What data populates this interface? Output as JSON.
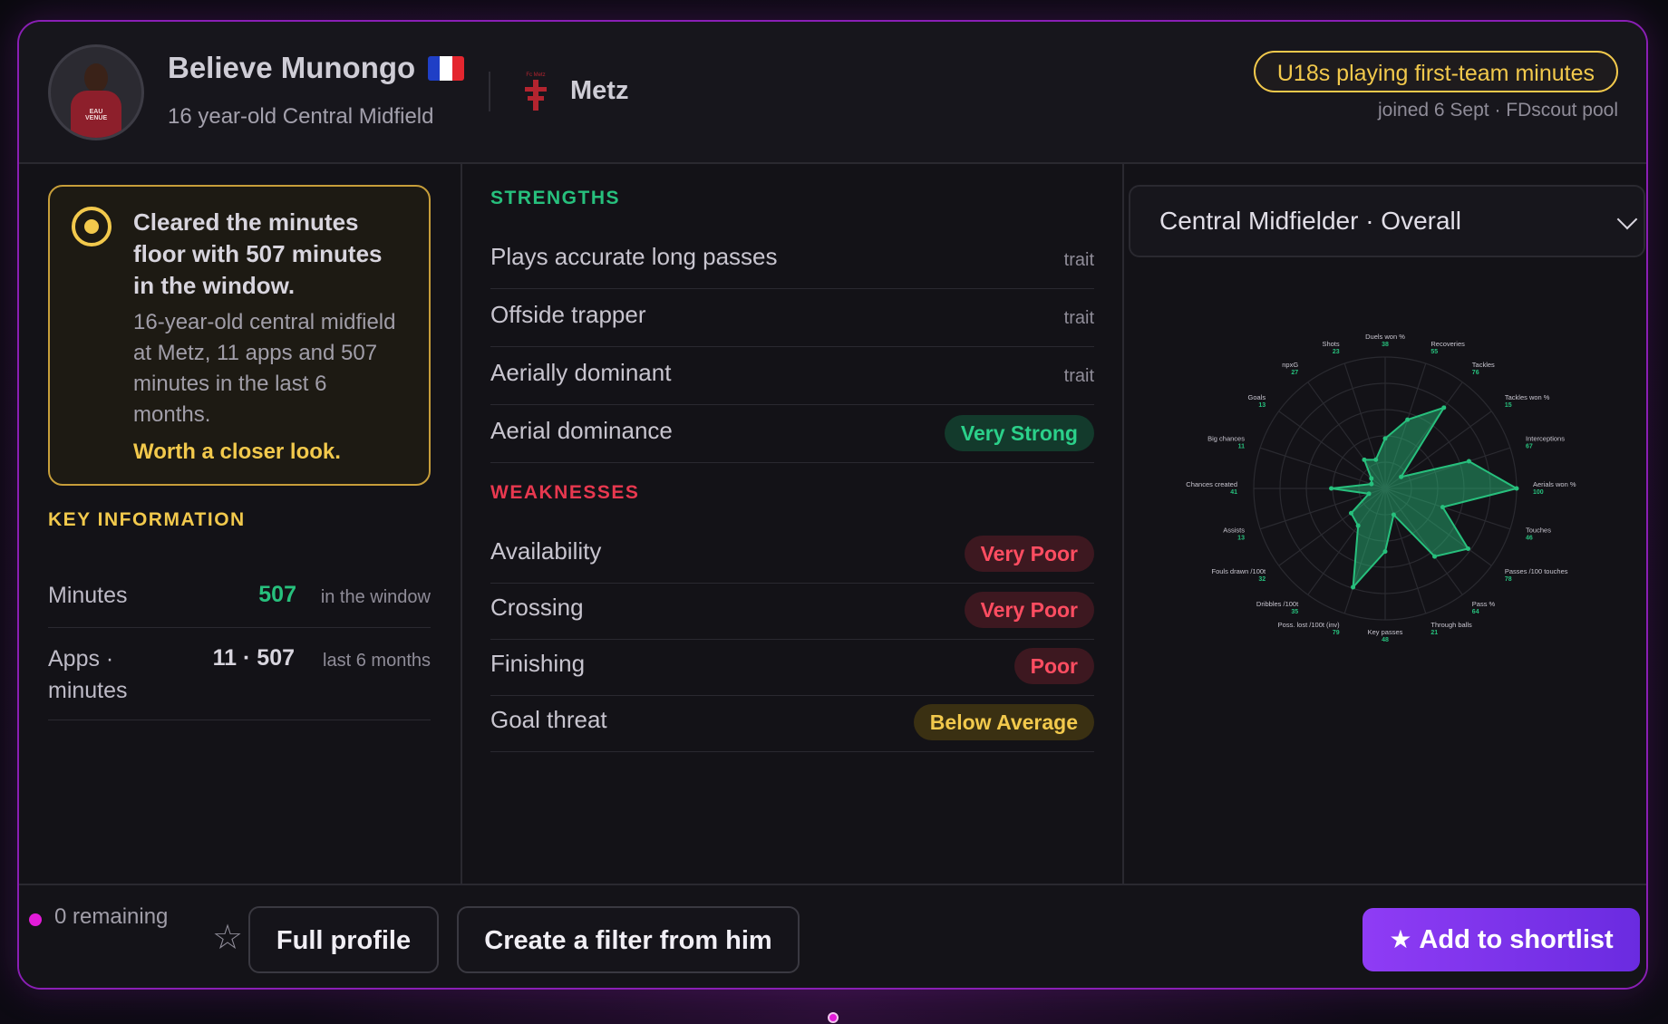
{
  "header": {
    "player_name": "Believe Munongo",
    "player_subtitle": "16 year-old Central Midfield",
    "club_name": "Metz",
    "tag": "U18s playing first-team minutes",
    "tag_subtitle": "joined 6 Sept · FDscout pool",
    "flag_colors": [
      "#1f3fc6",
      "#ffffff",
      "#e4262f"
    ],
    "avatar_crest_text": "EAU VENUE"
  },
  "notice": {
    "title": "Cleared the minutes floor with 507 minutes in the window.",
    "body": "16-year-old central midfield at Metz, 11 apps and 507 minutes in the last 6 months.",
    "cta": "Worth a closer look."
  },
  "key_information": {
    "label": "KEY INFORMATION",
    "rows": [
      {
        "label": "Minutes",
        "value": "507",
        "note": "in the window"
      },
      {
        "label": "Apps · minutes",
        "value": "11 · 507",
        "note": "last 6 months"
      }
    ]
  },
  "strengths": {
    "label": "STRENGTHS",
    "items": [
      {
        "name": "Plays accurate long passes",
        "tag": "trait"
      },
      {
        "name": "Offside trapper",
        "tag": "trait"
      },
      {
        "name": "Aerially dominant",
        "tag": "trait"
      },
      {
        "name": "Aerial dominance",
        "badge": "Very Strong"
      }
    ]
  },
  "weaknesses": {
    "label": "WEAKNESSES",
    "items": [
      {
        "name": "Availability",
        "badge": "Very Poor"
      },
      {
        "name": "Crossing",
        "badge": "Very Poor"
      },
      {
        "name": "Finishing",
        "badge": "Poor"
      },
      {
        "name": "Goal threat",
        "badge": "Below Average"
      }
    ]
  },
  "radar": {
    "dropdown_label": "Central Midfielder · Overall"
  },
  "chart_data": {
    "type": "radar",
    "range": [
      0,
      100
    ],
    "categories": [
      "Duels won %",
      "Recoveries",
      "Tackles",
      "Tackles won %",
      "Interceptions",
      "Aerials won %",
      "Touches",
      "Passes /100 touches",
      "Pass %",
      "Through balls",
      "Key passes",
      "Poss. lost /100t (inv)",
      "Dribbles /100t",
      "Fouls drawn /100t",
      "Assists",
      "Chances created",
      "Big chances",
      "Goals",
      "npxG",
      "Shots"
    ],
    "values": [
      38,
      55,
      76,
      15,
      67,
      100,
      46,
      78,
      64,
      21,
      48,
      79,
      35,
      32,
      13,
      41,
      11,
      13,
      27,
      23
    ],
    "color": "#27c07d"
  },
  "footer": {
    "remaining": "0 remaining",
    "full_profile": "Full profile",
    "create_filter": "Create a filter from him",
    "add_shortlist": "Add to shortlist"
  }
}
